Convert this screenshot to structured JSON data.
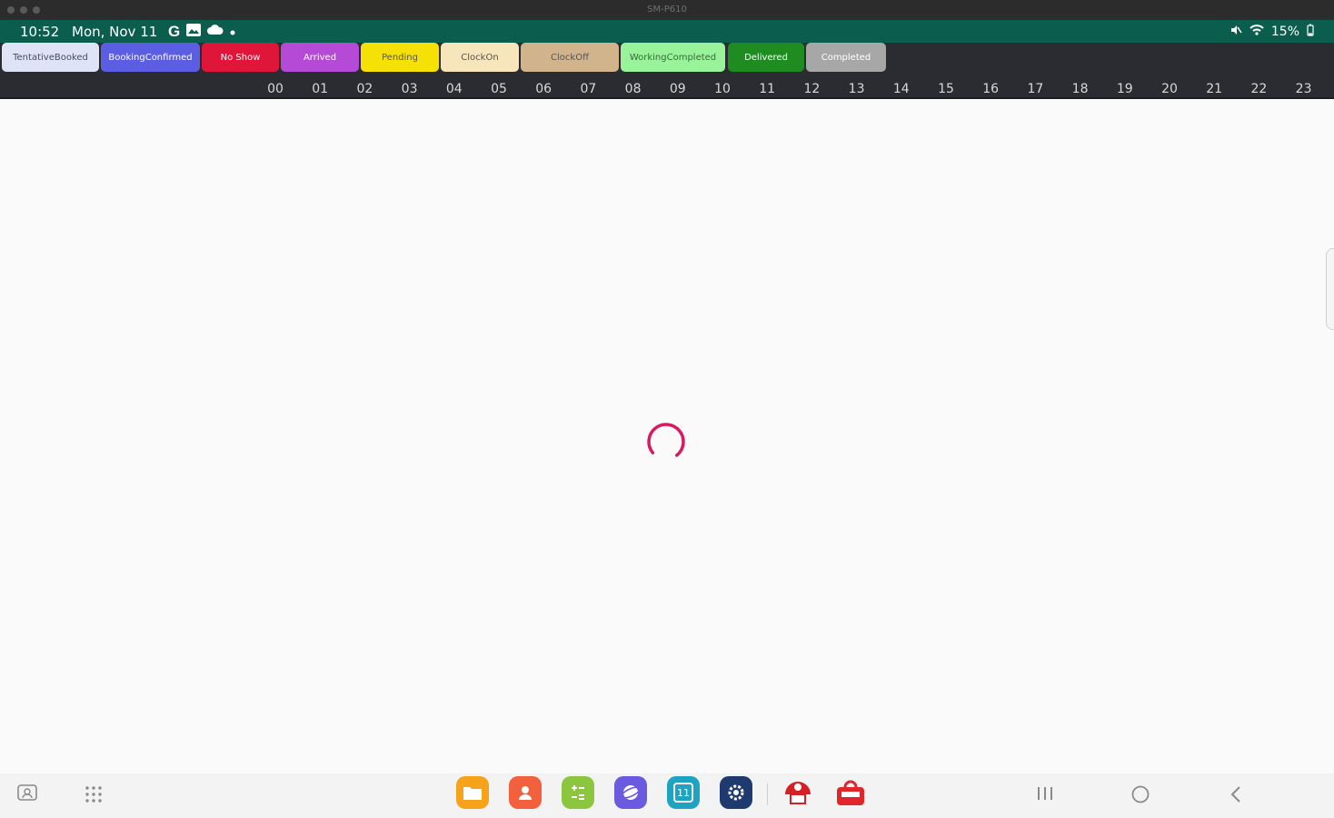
{
  "window": {
    "title": "SM-P610"
  },
  "status_bar": {
    "time": "10:52",
    "date": "Mon, Nov 11",
    "battery": "15%",
    "icons": [
      "google-icon",
      "photos-icon",
      "cloud-icon",
      "dot-icon",
      "mute-icon",
      "wifi-icon",
      "battery-icon"
    ]
  },
  "legend": [
    {
      "label": "TentativeBooked",
      "bg": "#dfe3f6",
      "fg": "#4a4a6a"
    },
    {
      "label": "BookingConfirmed",
      "bg": "#5b5ee3",
      "fg": "#ffffff"
    },
    {
      "label": "No Show",
      "bg": "#e0153a",
      "fg": "#ffffff"
    },
    {
      "label": "Arrived",
      "bg": "#b44ad6",
      "fg": "#ffffff"
    },
    {
      "label": "Pending",
      "bg": "#f6e106",
      "fg": "#555555"
    },
    {
      "label": "ClockOn",
      "bg": "#f7e5bb",
      "fg": "#555555"
    },
    {
      "label": "ClockOff",
      "bg": "#d1b38c",
      "fg": "#555555"
    },
    {
      "label": "WorkingCompleted",
      "bg": "#98f39a",
      "fg": "#3a6a3a"
    },
    {
      "label": "Delivered",
      "bg": "#1f8c22",
      "fg": "#ffffff"
    },
    {
      "label": "Completed",
      "bg": "#a7a7a7",
      "fg": "#ffffff"
    }
  ],
  "timeline": {
    "hours": [
      "00",
      "01",
      "02",
      "03",
      "04",
      "05",
      "06",
      "07",
      "08",
      "09",
      "10",
      "11",
      "12",
      "13",
      "14",
      "15",
      "16",
      "17",
      "18",
      "19",
      "20",
      "21",
      "22",
      "23"
    ]
  },
  "loading": {
    "spinner_color": "#d81b60"
  },
  "taskbar": {
    "apps": [
      {
        "name": "my-files-icon",
        "color": "#f7a21b"
      },
      {
        "name": "contacts-icon",
        "color": "#f2603d"
      },
      {
        "name": "calculator-icon",
        "color": "#8cc63f"
      },
      {
        "name": "internet-icon",
        "color": "#6a5ae0"
      },
      {
        "name": "calendar-icon",
        "color": "#1ea3c3"
      },
      {
        "name": "settings-icon",
        "color": "#1e3a6e"
      }
    ],
    "recent_apps": [
      {
        "name": "app-red-badge-icon",
        "color": "#d62027"
      },
      {
        "name": "app-red-shop-icon",
        "color": "#e0252b"
      }
    ],
    "calendar_day": "11"
  }
}
